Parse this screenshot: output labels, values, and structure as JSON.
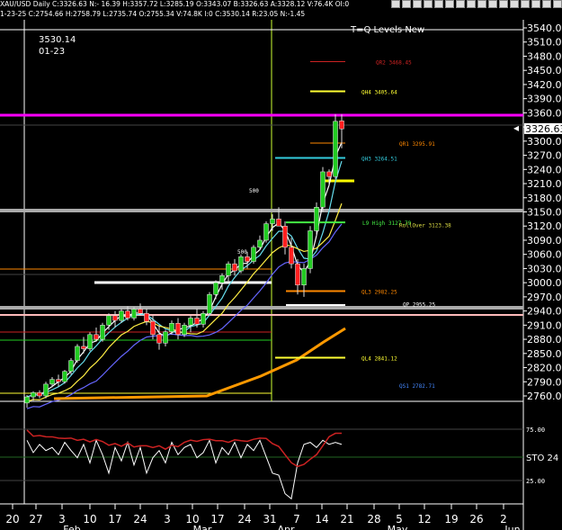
{
  "header": {
    "title": "XAU/USD Daily C:3326.63 N:- 16.39 H:3357.72 L:3285.19 O:3343.07 B:3326.63 A:3328.12 V:76.4K OI:0",
    "subtitle": "1-23-25 C:2754.66 H:2758.79 L:2735.74 O:2755.34 V:74.8K I:0 C:3530.14 R:23.05 N:-1.45"
  },
  "overlay": {
    "value": "3530.14",
    "date": "01-23",
    "study_name": "T=Q Levels New"
  },
  "toolbar_icons": [
    "zoom-in-icon",
    "zoom-out-icon",
    "cursor-icon",
    "crosshair-icon",
    "draw-icon",
    "text-icon",
    "fib-icon",
    "line-icon",
    "channel-icon",
    "arrow-icon",
    "rect-icon",
    "ellipse-icon",
    "chart-type-icon",
    "settings-icon",
    "refresh-icon",
    "close-icon"
  ],
  "colors": {
    "magenta_line": "#ff00ff",
    "orange_ma": "#ff9900",
    "red_candle": "#ff2020",
    "green_candle": "#22cc22",
    "gray_band": "#aaaaaa",
    "pink_band": "#ffbbbb"
  },
  "chart_data": {
    "type": "candlestick",
    "price_axis": {
      "ticks": [
        "3540.00",
        "3510.00",
        "3480.00",
        "3450.00",
        "3420.00",
        "3390.00",
        "3360.00",
        "3330.00",
        "3300.00",
        "3270.00",
        "3240.00",
        "3210.00",
        "3180.00",
        "3150.00",
        "3120.00",
        "3090.00",
        "3060.00",
        "3030.00",
        "3000.00",
        "2970.00",
        "2940.00",
        "2910.00",
        "2880.00",
        "2850.00",
        "2820.00",
        "2790.00",
        "2760.00"
      ],
      "range": [
        2748,
        3550
      ],
      "last_price": "3326.63"
    },
    "date_axis": {
      "ticks": [
        "20",
        "27",
        "3",
        "10",
        "17",
        "24",
        "3",
        "10",
        "17",
        "24",
        "31",
        "7",
        "14",
        "21",
        "28",
        "5",
        "12",
        "19",
        "26",
        "2"
      ],
      "months": [
        "Feb",
        "Mar",
        "Apr",
        "May",
        "Jun"
      ]
    },
    "levels": [
      {
        "label": "QR2 3468.45",
        "price": 3468.45,
        "color": "#cc2222"
      },
      {
        "label": "QH4 3405.64",
        "price": 3405.64,
        "color": "#ffff33"
      },
      {
        "label": "QR1 3295.91",
        "price": 3295.91,
        "color": "#ff8800"
      },
      {
        "label": "QH3 3264.51",
        "price": 3264.51,
        "color": "#33ccdd"
      },
      {
        "label": "L9 High 3127.79",
        "price": 3127.79,
        "color": "#44ee44"
      },
      {
        "label": "RollOver 3123.38",
        "price": 3123.38,
        "color": "#dddd44"
      },
      {
        "label": "QL3 2982.25",
        "price": 2982.25,
        "color": "#ff8800"
      },
      {
        "label": "QP 2955.25",
        "price": 2955.25,
        "color": "#ffffff"
      },
      {
        "label": "QL4 2841.12",
        "price": 2841.12,
        "color": "#ffff33"
      },
      {
        "label": "QS1 2782.71",
        "price": 2782.71,
        "color": "#4488ff"
      }
    ],
    "annotations": [
      "500",
      "500"
    ],
    "candles": [
      [
        2745,
        2762,
        2735,
        2758
      ],
      [
        2758,
        2770,
        2750,
        2767
      ],
      [
        2767,
        2772,
        2755,
        2760
      ],
      [
        2760,
        2790,
        2755,
        2785
      ],
      [
        2785,
        2800,
        2778,
        2795
      ],
      [
        2795,
        2805,
        2780,
        2790
      ],
      [
        2790,
        2815,
        2786,
        2812
      ],
      [
        2812,
        2840,
        2805,
        2835
      ],
      [
        2835,
        2870,
        2830,
        2865
      ],
      [
        2865,
        2885,
        2850,
        2860
      ],
      [
        2860,
        2895,
        2855,
        2890
      ],
      [
        2890,
        2905,
        2875,
        2880
      ],
      [
        2880,
        2915,
        2875,
        2910
      ],
      [
        2910,
        2935,
        2900,
        2930
      ],
      [
        2930,
        2940,
        2905,
        2920
      ],
      [
        2920,
        2945,
        2915,
        2940
      ],
      [
        2940,
        2950,
        2920,
        2925
      ],
      [
        2925,
        2948,
        2920,
        2944
      ],
      [
        2944,
        2956,
        2930,
        2935
      ],
      [
        2935,
        2945,
        2910,
        2918
      ],
      [
        2918,
        2930,
        2880,
        2890
      ],
      [
        2890,
        2910,
        2858,
        2872
      ],
      [
        2872,
        2900,
        2865,
        2896
      ],
      [
        2896,
        2920,
        2890,
        2914
      ],
      [
        2914,
        2925,
        2880,
        2890
      ],
      [
        2890,
        2915,
        2885,
        2910
      ],
      [
        2910,
        2930,
        2895,
        2925
      ],
      [
        2925,
        2945,
        2905,
        2912
      ],
      [
        2912,
        2940,
        2905,
        2935
      ],
      [
        2935,
        2980,
        2930,
        2975
      ],
      [
        2975,
        3005,
        2965,
        3000
      ],
      [
        3000,
        3020,
        2985,
        3015
      ],
      [
        3015,
        3045,
        3000,
        3040
      ],
      [
        3040,
        3050,
        3015,
        3025
      ],
      [
        3025,
        3060,
        3020,
        3055
      ],
      [
        3055,
        3065,
        3030,
        3045
      ],
      [
        3045,
        3080,
        3040,
        3075
      ],
      [
        3075,
        3100,
        3070,
        3090
      ],
      [
        3090,
        3130,
        3085,
        3125
      ],
      [
        3125,
        3145,
        3110,
        3135
      ],
      [
        3135,
        3160,
        3120,
        3120
      ],
      [
        3120,
        3130,
        3060,
        3075
      ],
      [
        3075,
        3095,
        3030,
        3040
      ],
      [
        3040,
        3050,
        2975,
        2995
      ],
      [
        2995,
        3040,
        2970,
        3030
      ],
      [
        3030,
        3120,
        3020,
        3110
      ],
      [
        3110,
        3170,
        3100,
        3160
      ],
      [
        3160,
        3245,
        3150,
        3235
      ],
      [
        3235,
        3240,
        3205,
        3225
      ],
      [
        3225,
        3357,
        3220,
        3342
      ],
      [
        3343,
        3357,
        3285,
        3326
      ]
    ]
  }
}
